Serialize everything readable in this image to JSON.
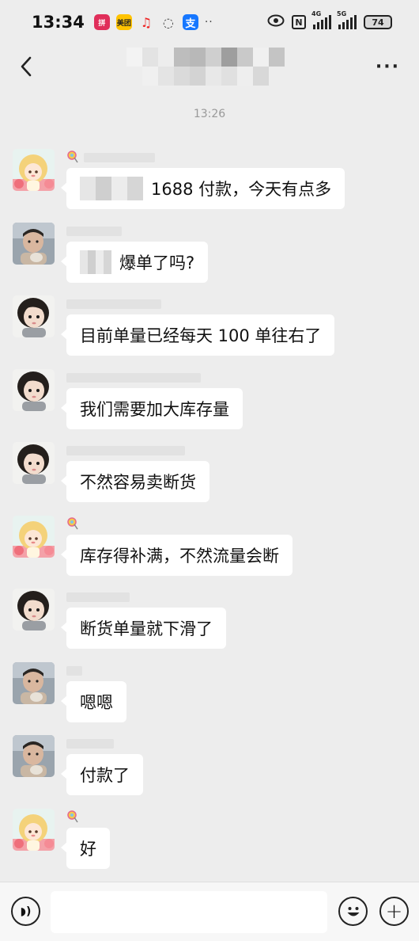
{
  "status_bar": {
    "time": "13:34",
    "apps": [
      {
        "name": "pinduoduo-icon",
        "glyph": "拼"
      },
      {
        "name": "meituan-icon",
        "glyph": "美团"
      },
      {
        "name": "music-icon",
        "glyph": "♫"
      },
      {
        "name": "chat-bubble-icon",
        "glyph": "◌"
      },
      {
        "name": "alipay-icon",
        "glyph": "支"
      }
    ],
    "more_dots": "··",
    "network_1": "4G",
    "network_2": "5G",
    "nfc": "N",
    "battery": "74"
  },
  "nav": {
    "back_glyph": "‹",
    "more_glyph": "···"
  },
  "timestamp": "13:26",
  "messages": [
    {
      "sender": "a",
      "name_has_icon": true,
      "text": "1688 付款，今天有点多",
      "redacted_prefix": true
    },
    {
      "sender": "b",
      "name_has_icon": false,
      "text": "爆单了吗?",
      "redacted_prefix": true
    },
    {
      "sender": "c",
      "name_has_icon": false,
      "text": "目前单量已经每天 100 单往右了",
      "redacted_prefix": false
    },
    {
      "sender": "c",
      "name_has_icon": false,
      "text": "我们需要加大库存量",
      "redacted_prefix": false
    },
    {
      "sender": "c",
      "name_has_icon": false,
      "text": "不然容易卖断货",
      "redacted_prefix": false
    },
    {
      "sender": "a",
      "name_has_icon": true,
      "text": "库存得补满，不然流量会断",
      "redacted_prefix": false
    },
    {
      "sender": "c",
      "name_has_icon": false,
      "text": "断货单量就下滑了",
      "redacted_prefix": false
    },
    {
      "sender": "b",
      "name_has_icon": false,
      "text": "嗯嗯",
      "redacted_prefix": false
    },
    {
      "sender": "b",
      "name_has_icon": false,
      "text": "付款了",
      "redacted_prefix": false
    },
    {
      "sender": "a",
      "name_has_icon": true,
      "text": "好",
      "redacted_prefix": false
    }
  ],
  "input_bar": {
    "input_value": "",
    "voice_glyph": "◗)",
    "plus_glyph": "+"
  },
  "colors": {
    "background": "#ededed",
    "bubble": "#ffffff",
    "input_bar": "#f7f7f7"
  }
}
